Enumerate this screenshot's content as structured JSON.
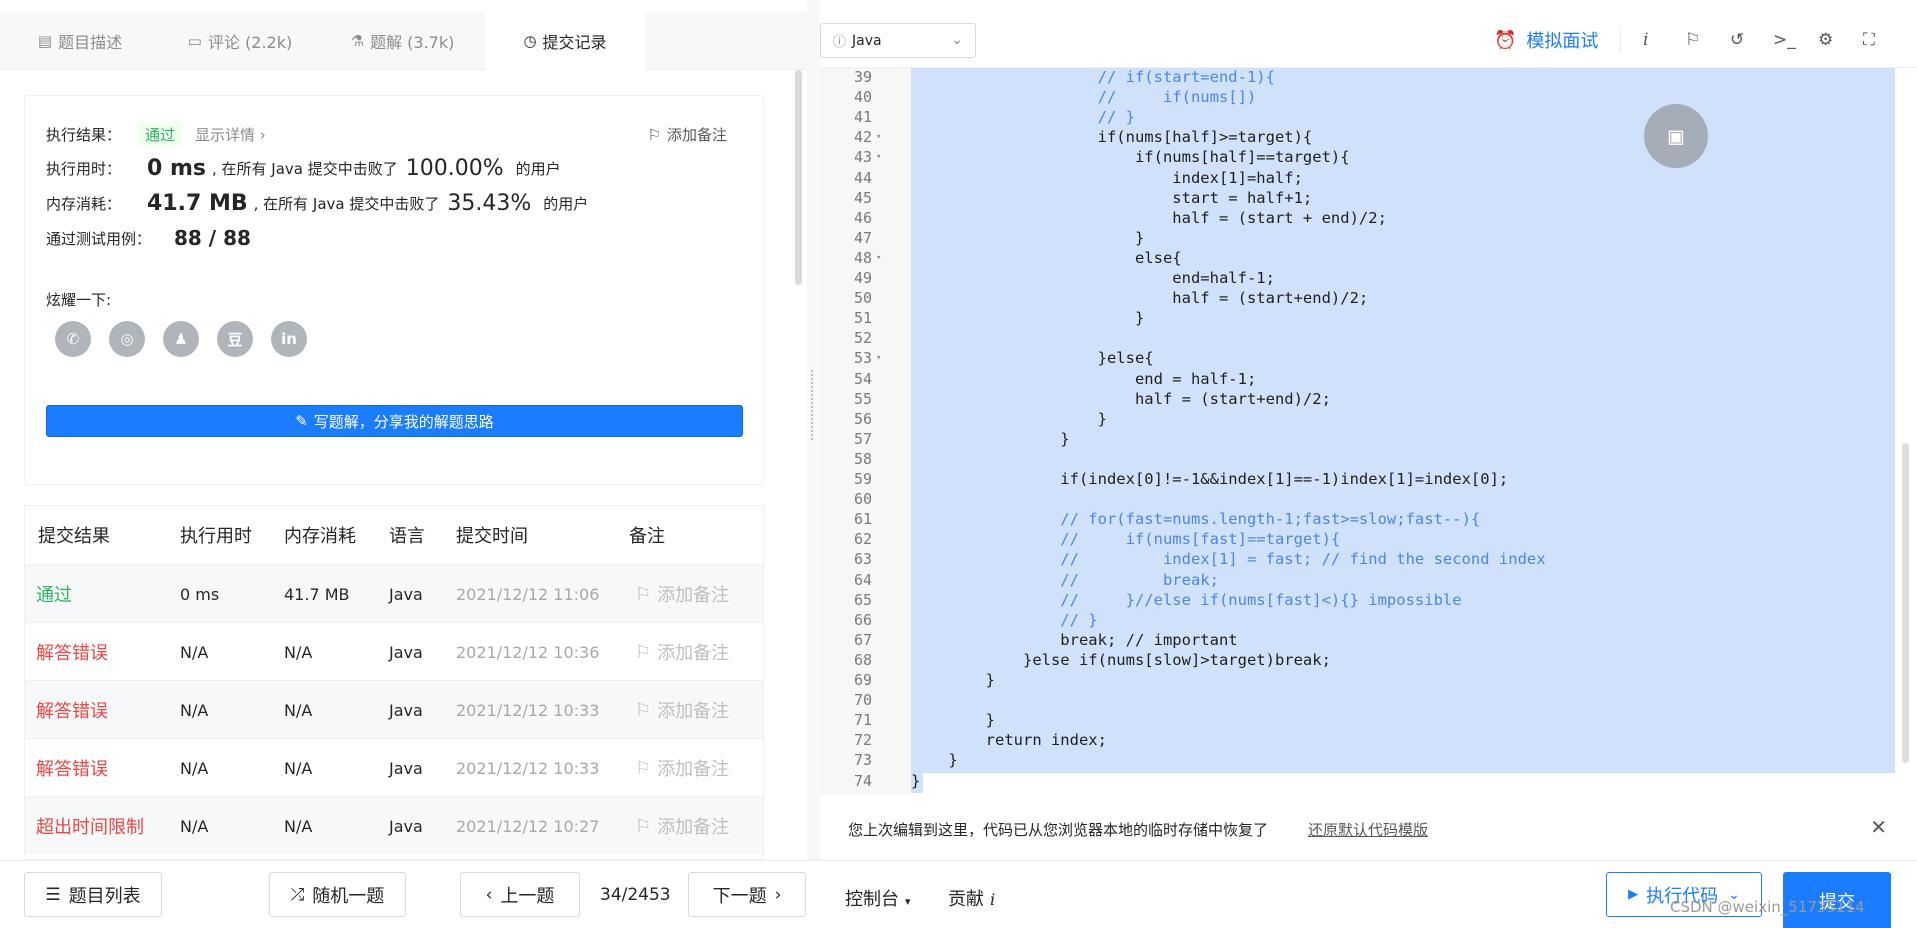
{
  "tabs": [
    {
      "label": "题目描述",
      "icon": "description-icon"
    },
    {
      "label": "评论 (2.2k)",
      "icon": "comment-icon"
    },
    {
      "label": "题解 (3.7k)",
      "icon": "flask-icon"
    },
    {
      "label": "提交记录",
      "icon": "clock-icon"
    }
  ],
  "result": {
    "status_label": "执行结果：",
    "status_value": "通过",
    "show_details": "显示详情 ›",
    "add_note": "添加备注",
    "time_label": "执行用时：",
    "time_value": "0 ms",
    "time_mid": ", 在所有 Java 提交中击败了",
    "time_pct": "100.00%",
    "time_suffix": "的用户",
    "mem_label": "内存消耗：",
    "mem_value": "41.7 MB",
    "mem_mid": ", 在所有 Java 提交中击败了",
    "mem_pct": "35.43%",
    "mem_suffix": "的用户",
    "cases_label": "通过测试用例：",
    "cases_value": "88  /  88",
    "share_label": "炫耀一下:",
    "share_icons": [
      "wechat-icon",
      "weibo-icon",
      "qq-icon",
      "douban-icon",
      "linkedin-icon"
    ],
    "share_glyphs": [
      "✆",
      "◎",
      "♟",
      "豆",
      "in"
    ],
    "write_button": "写题解，分享我的解题思路"
  },
  "submissions": {
    "headers": [
      "提交结果",
      "执行用时",
      "内存消耗",
      "语言",
      "提交时间",
      "备注"
    ],
    "rows": [
      {
        "status": "通过",
        "status_type": "pass",
        "time": "0 ms",
        "memory": "41.7 MB",
        "lang": "Java",
        "submitted": "2021/12/12 11:06",
        "note": "添加备注"
      },
      {
        "status": "解答错误",
        "status_type": "fail",
        "time": "N/A",
        "memory": "N/A",
        "lang": "Java",
        "submitted": "2021/12/12 10:36",
        "note": "添加备注"
      },
      {
        "status": "解答错误",
        "status_type": "fail",
        "time": "N/A",
        "memory": "N/A",
        "lang": "Java",
        "submitted": "2021/12/12 10:33",
        "note": "添加备注"
      },
      {
        "status": "解答错误",
        "status_type": "fail",
        "time": "N/A",
        "memory": "N/A",
        "lang": "Java",
        "submitted": "2021/12/12 10:33",
        "note": "添加备注"
      },
      {
        "status": "超出时间限制",
        "status_type": "fail",
        "time": "N/A",
        "memory": "N/A",
        "lang": "Java",
        "submitted": "2021/12/12 10:27",
        "note": "添加备注"
      }
    ]
  },
  "toolbar": {
    "language": "Java",
    "mock_interview": "模拟面试",
    "icons": [
      "info-icon",
      "run-flag-icon",
      "reset-icon",
      "terminal-icon",
      "settings-icon",
      "fullscreen-icon"
    ]
  },
  "editor": {
    "lines": [
      {
        "n": "39",
        "text": "                    // if(start=end-1){",
        "type": "com"
      },
      {
        "n": "40",
        "text": "                    //     if(nums[])",
        "type": "com"
      },
      {
        "n": "41",
        "text": "                    // }",
        "type": "com"
      },
      {
        "n": "42",
        "text": "                    if(nums[half]>=target){",
        "type": "code",
        "fold": true
      },
      {
        "n": "43",
        "text": "                        if(nums[half]==target){",
        "type": "code",
        "fold": true
      },
      {
        "n": "44",
        "text": "                            index[1]=half;",
        "type": "code"
      },
      {
        "n": "45",
        "text": "                            start = half+1;",
        "type": "code"
      },
      {
        "n": "46",
        "text": "                            half = (start + end)/2;",
        "type": "code"
      },
      {
        "n": "47",
        "text": "                        }",
        "type": "code"
      },
      {
        "n": "48",
        "text": "                        else{",
        "type": "code",
        "fold": true
      },
      {
        "n": "49",
        "text": "                            end=half-1;",
        "type": "code"
      },
      {
        "n": "50",
        "text": "                            half = (start+end)/2;",
        "type": "code"
      },
      {
        "n": "51",
        "text": "                        }",
        "type": "code"
      },
      {
        "n": "52",
        "text": "",
        "type": "code"
      },
      {
        "n": "53",
        "text": "                    }else{",
        "type": "code",
        "fold": true
      },
      {
        "n": "54",
        "text": "                        end = half-1;",
        "type": "code"
      },
      {
        "n": "55",
        "text": "                        half = (start+end)/2;",
        "type": "code"
      },
      {
        "n": "56",
        "text": "                    }",
        "type": "code"
      },
      {
        "n": "57",
        "text": "                }",
        "type": "code"
      },
      {
        "n": "58",
        "text": "",
        "type": "code"
      },
      {
        "n": "59",
        "text": "                if(index[0]!=-1&&index[1]==-1)index[1]=index[0];",
        "type": "code"
      },
      {
        "n": "60",
        "text": "",
        "type": "code"
      },
      {
        "n": "61",
        "text": "                // for(fast=nums.length-1;fast>=slow;fast--){",
        "type": "com"
      },
      {
        "n": "62",
        "text": "                //     if(nums[fast]==target){",
        "type": "com"
      },
      {
        "n": "63",
        "text": "                //         index[1] = fast; // find the second index",
        "type": "com"
      },
      {
        "n": "64",
        "text": "                //         break;",
        "type": "com"
      },
      {
        "n": "65",
        "text": "                //     }//else if(nums[fast]<){} impossible",
        "type": "com"
      },
      {
        "n": "66",
        "text": "                // }",
        "type": "com"
      },
      {
        "n": "67",
        "text": "                break; // important",
        "type": "code"
      },
      {
        "n": "68",
        "text": "            }else if(nums[slow]>target)break;",
        "type": "code"
      },
      {
        "n": "69",
        "text": "        }",
        "type": "code"
      },
      {
        "n": "70",
        "text": "",
        "type": "code"
      },
      {
        "n": "71",
        "text": "        }",
        "type": "code"
      },
      {
        "n": "72",
        "text": "        return index;",
        "type": "code"
      },
      {
        "n": "73",
        "text": "    }",
        "type": "code"
      },
      {
        "n": "74",
        "text": "}",
        "type": "code"
      }
    ]
  },
  "restore": {
    "message": "您上次编辑到这里，代码已从您浏览器本地的临时存储中恢复了",
    "link": "还原默认代码模版"
  },
  "bottom": {
    "problem_list": "题目列表",
    "random": "随机一题",
    "prev": "上一题",
    "page": "34/2453",
    "next": "下一题",
    "console": "控制台",
    "contribute": "贡献",
    "run": "执行代码",
    "submit": "提交"
  },
  "watermark": "CSDN @weixin_51735114",
  "colors": {
    "accent": "#1a7cff",
    "pass": "#2db55d",
    "fail": "#ef4743",
    "selection": "#cfe1fb"
  }
}
